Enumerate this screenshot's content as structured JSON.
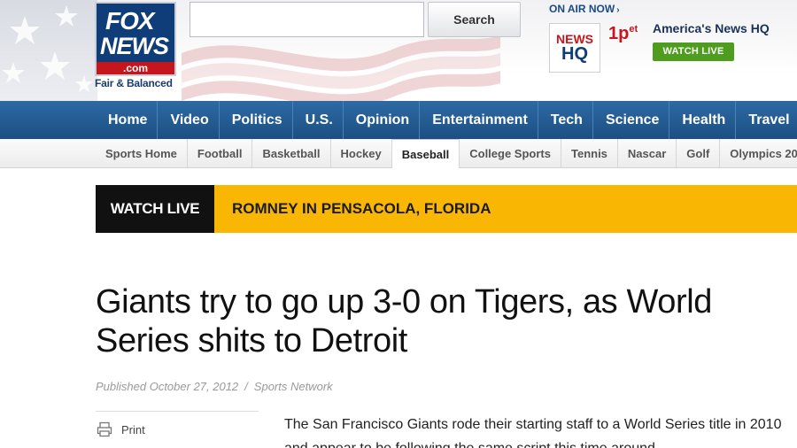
{
  "header": {
    "logo": {
      "line1": "FOX",
      "line2": "NEWS",
      "domain": ".com",
      "tagline": "Fair & Balanced"
    },
    "search": {
      "value": "",
      "placeholder": "",
      "button_label": "Search"
    },
    "on_air": {
      "label": "ON AIR NOW",
      "chevron": "›",
      "badge_line1": "NEWS",
      "badge_line2": "HQ",
      "time": "1p",
      "time_zone": "et",
      "show": "America's News HQ",
      "watch_button": "WATCH LIVE"
    }
  },
  "main_nav": {
    "items": [
      "Home",
      "Video",
      "Politics",
      "U.S.",
      "Opinion",
      "Entertainment",
      "Tech",
      "Science",
      "Health",
      "Travel"
    ]
  },
  "sub_nav": {
    "items": [
      "Sports Home",
      "Football",
      "Basketball",
      "Hockey",
      "Baseball",
      "College Sports",
      "Tennis",
      "Nascar",
      "Golf",
      "Olympics 20"
    ],
    "active": "Baseball"
  },
  "banner": {
    "label": "WATCH LIVE",
    "text": "ROMNEY IN PENSACOLA, FLORIDA"
  },
  "article": {
    "headline": "Giants try to go up 3-0 on Tigers, as World Series shits to Detroit",
    "published": "Published October 27, 2012",
    "separator": "/",
    "source": "Sports Network",
    "tools": {
      "print_label": "Print"
    },
    "body": "The San Francisco Giants rode their starting staff to a World Series title in 2010 and appear to be following the same script this time around."
  },
  "colors": {
    "nav_blue": "#1b4f83",
    "brand_red": "#c4161c",
    "banner_yellow": "#f9b703",
    "watch_green": "#4f9d1e"
  },
  "icons": {
    "print": "print-icon",
    "stars": "stars-decoration",
    "flag": "flag-decoration"
  }
}
